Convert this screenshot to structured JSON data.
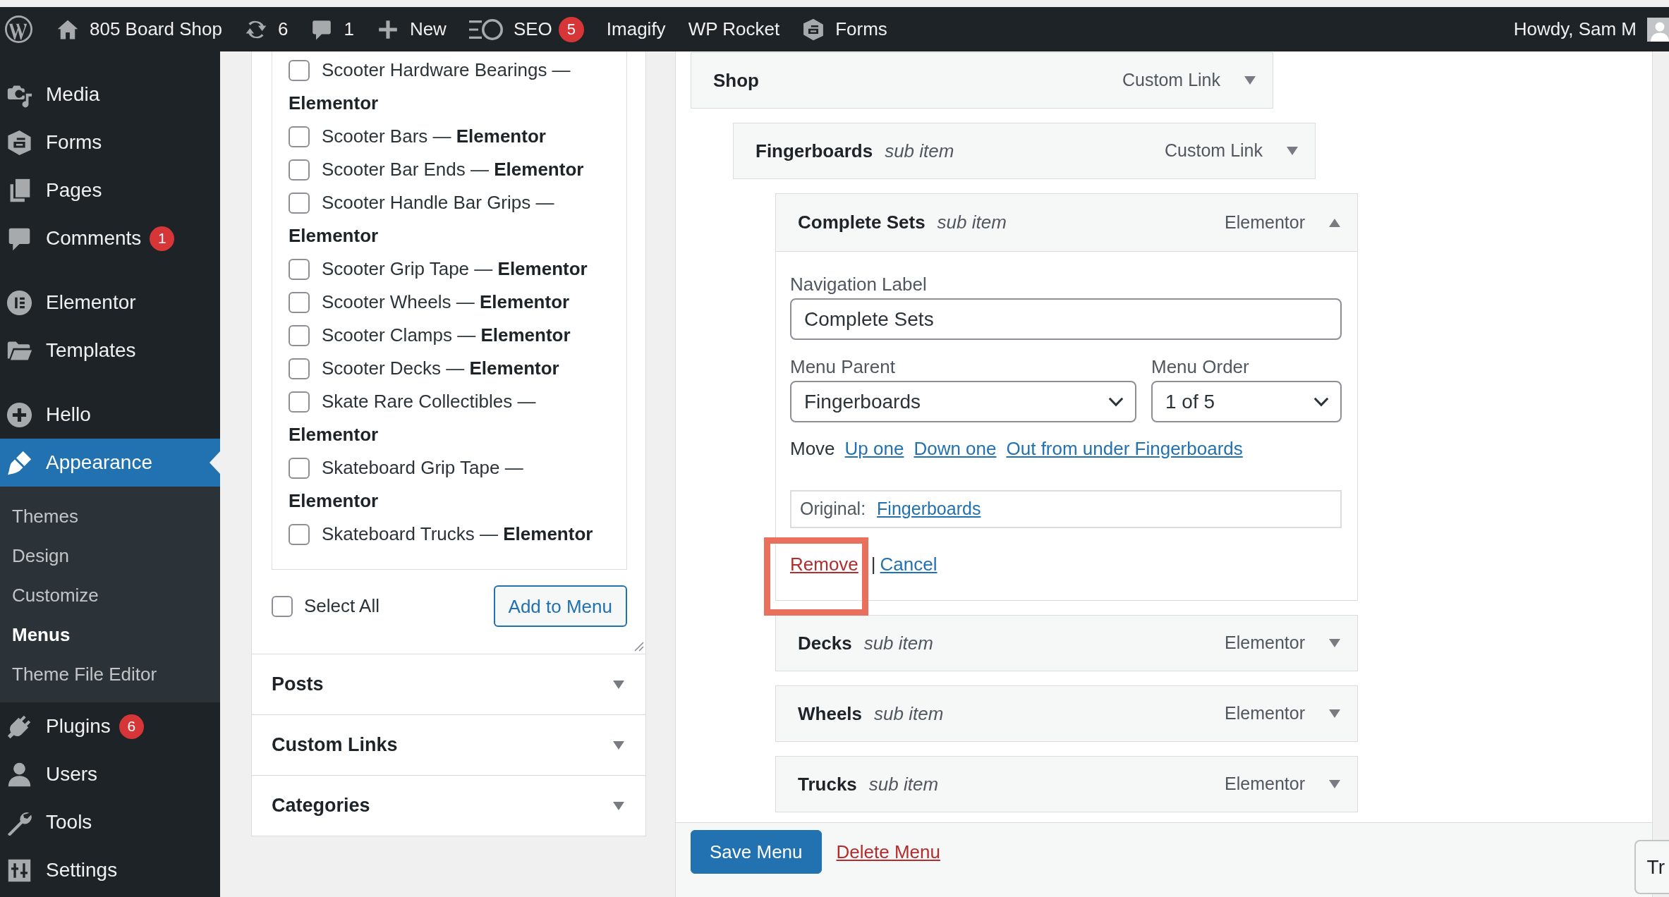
{
  "admin_bar": {
    "items": [
      {
        "kind": "logo"
      },
      {
        "kind": "home",
        "label": "805 Board Shop"
      },
      {
        "kind": "updates",
        "label": "6"
      },
      {
        "kind": "comments",
        "label": "1"
      },
      {
        "kind": "new",
        "label": "New"
      },
      {
        "kind": "seo",
        "label": "SEO",
        "badge": "5"
      },
      {
        "kind": "text",
        "label": "Imagify"
      },
      {
        "kind": "text",
        "label": "WP Rocket"
      },
      {
        "kind": "forms",
        "label": "Forms"
      }
    ],
    "greeting": "Howdy, Sam M"
  },
  "sidebar": {
    "groups": [
      {
        "items": [
          {
            "kind": "media",
            "label": "Media",
            "selected": false
          },
          {
            "kind": "forms",
            "label": "Forms",
            "selected": false
          },
          {
            "kind": "pages",
            "label": "Pages",
            "selected": false
          },
          {
            "kind": "comments",
            "label": "Comments",
            "badge": "1",
            "selected": false
          }
        ]
      },
      {
        "items": [
          {
            "kind": "elementor",
            "label": "Elementor",
            "selected": false
          },
          {
            "kind": "templates",
            "label": "Templates",
            "selected": false
          }
        ]
      },
      {
        "items": [
          {
            "kind": "hello",
            "label": "Hello",
            "selected": false
          },
          {
            "kind": "appearance",
            "label": "Appearance",
            "selected": true,
            "children": [
              {
                "label": "Themes",
                "selected": false
              },
              {
                "label": "Design",
                "selected": false
              },
              {
                "label": "Customize",
                "selected": false
              },
              {
                "label": "Menus",
                "selected": true
              },
              {
                "label": "Theme File Editor",
                "selected": false
              }
            ]
          },
          {
            "kind": "plugins",
            "label": "Plugins",
            "badge": "6",
            "selected": false
          },
          {
            "kind": "users",
            "label": "Users",
            "selected": false
          },
          {
            "kind": "tools",
            "label": "Tools",
            "selected": false
          },
          {
            "kind": "settings",
            "label": "Settings",
            "selected": false
          }
        ]
      }
    ]
  },
  "item_picker": {
    "pages": [
      {
        "label": "Scooter Hardware Bearings —",
        "source": "Elementor",
        "checked": false
      },
      {
        "label": "Scooter Bars —",
        "source": "Elementor",
        "checked": false
      },
      {
        "label": "Scooter Bar Ends —",
        "source": "Elementor",
        "checked": false
      },
      {
        "label": "Scooter Handle Bar Grips —",
        "source": "Elementor",
        "checked": false
      },
      {
        "label": "Scooter Grip Tape —",
        "source": "Elementor",
        "checked": false
      },
      {
        "label": "Scooter Wheels —",
        "source": "Elementor",
        "checked": false
      },
      {
        "label": "Scooter Clamps —",
        "source": "Elementor",
        "checked": false
      },
      {
        "label": "Scooter Decks —",
        "source": "Elementor",
        "checked": false
      },
      {
        "label": "Skate Rare Collectibles —",
        "source": "Elementor",
        "checked": false
      },
      {
        "label": "Skateboard Grip Tape —",
        "source": "Elementor",
        "checked": false
      },
      {
        "label": "Skateboard Trucks —",
        "source": "Elementor",
        "checked": false
      }
    ],
    "select_all": {
      "label": "Select All",
      "checked": false
    },
    "add_button": "Add to Menu",
    "sections": [
      {
        "title": "Posts",
        "expanded": false
      },
      {
        "title": "Custom Links",
        "expanded": false
      },
      {
        "title": "Categories",
        "expanded": false
      }
    ]
  },
  "menu_structure": {
    "items": [
      {
        "title": "Shop",
        "type": "Custom Link",
        "expanded": false,
        "children": [
          {
            "title": "Fingerboards",
            "subtitle": "sub item",
            "type": "Custom Link",
            "expanded": false,
            "children": [
              {
                "title": "Complete Sets",
                "subtitle": "sub item",
                "type": "Elementor",
                "expanded": true,
                "settings": {
                  "navigation_label": {
                    "label": "Navigation Label",
                    "value": "Complete Sets"
                  },
                  "menu_parent": {
                    "label": "Menu Parent",
                    "value": "Fingerboards"
                  },
                  "menu_order": {
                    "label": "Menu Order",
                    "value": "1 of 5"
                  },
                  "move": {
                    "label": "Move",
                    "links": [
                      "Up one",
                      "Down one",
                      "Out from under Fingerboards"
                    ]
                  },
                  "original": {
                    "label": "Original:",
                    "link": "Fingerboards"
                  },
                  "actions": [
                    {
                      "kind": "remove",
                      "label": "Remove",
                      "highlighted": true
                    },
                    {
                      "kind": "cancel",
                      "label": "Cancel",
                      "highlighted": false
                    }
                  ],
                  "action_separator": "|"
                }
              },
              {
                "title": "Decks",
                "subtitle": "sub item",
                "type": "Elementor",
                "expanded": false
              },
              {
                "title": "Wheels",
                "subtitle": "sub item",
                "type": "Elementor",
                "expanded": false
              },
              {
                "title": "Trucks",
                "subtitle": "sub item",
                "type": "Elementor",
                "expanded": false
              }
            ]
          }
        ]
      }
    ]
  },
  "footer": {
    "save_button": "Save Menu",
    "delete_link": "Delete Menu"
  },
  "floating_button": {
    "label": "Tr"
  }
}
